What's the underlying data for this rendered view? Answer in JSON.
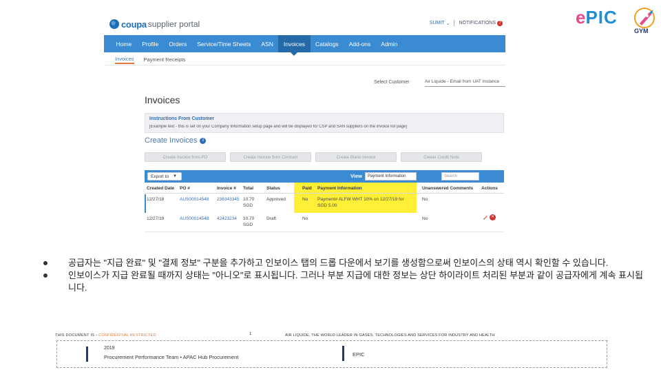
{
  "portal": {
    "brand": "coupa",
    "brand_sub": "supplier portal",
    "user": "SUMIT",
    "user_caret": "⌄",
    "notifications": "NOTIFICATIONS",
    "notif_count": "7",
    "nav": [
      "Home",
      "Profile",
      "Orders",
      "Service/Time Sheets",
      "ASN",
      "Invoices",
      "Catalogs",
      "Add-ons",
      "Admin"
    ],
    "active_nav": "Invoices",
    "subnav": [
      "Invoices",
      "Payment Receipts"
    ],
    "select_customer_label": "Select Customer",
    "select_customer_value": "Air Liquide - Email from UAT Instance",
    "page_title": "Invoices",
    "instructions_title": "Instructions From Customer",
    "instructions_text": "[Example text - this is set on your Company Information setup page and will be displayed for CSP and SAN suppliers on the invoice list page]",
    "create_title": "Create Invoices",
    "create_buttons": [
      "Create Invoice from PO",
      "Create Invoice from Contract",
      "Create Blank Invoice",
      "Create Credit Note"
    ],
    "export_label": "Export to",
    "view_label": "View",
    "view_value": "Payment Information",
    "search_placeholder": "Search",
    "columns": [
      "Created Date",
      "PO #",
      "Invoice #",
      "Total",
      "Status",
      "Paid",
      "Payment Information",
      "Unanswered Comments",
      "Actions"
    ],
    "rows": [
      {
        "created": "12/27/18",
        "po": "AUS00014548",
        "invoice": "236343345",
        "total_1": "10.70",
        "total_2": "SGD",
        "status": "Approved",
        "paid": "No",
        "payment_1": "Payment# ALFW WHT 10% on 12/27/19 for",
        "payment_2": "SGD 5.00",
        "comments": "No"
      },
      {
        "created": "12/27/19",
        "po": "AUS00014548",
        "invoice": "42423234",
        "total_1": "10.70",
        "total_2": "SGD",
        "status": "Draft",
        "paid": "No",
        "payment_1": "",
        "payment_2": "",
        "comments": "No"
      }
    ]
  },
  "logos": {
    "epic_e": "e",
    "epic_rest": "PIC",
    "gym": "GYM"
  },
  "bullets": [
    "공급자는 \"지급 완료\" 및 \"결제 정보\" 구분을 추가하고 인보이스 탭의 드롭 다운에서 보기를 생성함으로써 인보이스의 상태 역시 확인할 수 있습니다.",
    "인보이스가 지급 완료될 때까지 상태는 \"아니오\"로 표시됩니다. 그러나 부분 지급에 대한 정보는 상단 하이라이트 처리된 부분과 같이 공급자에게 계속 표시됩니다."
  ],
  "footer": {
    "conf_prefix": "THIS DOCUMENT IS ",
    "conf_label": "• CONFIDENTIAL RESTRICTED",
    "page_num": "1",
    "tagline": "AIR LIQUIDE, THE WORLD LEADER IN GASES, TECHNOLOGIES AND SERVICES FOR INDUSTRY AND HEALTH",
    "year": "2019",
    "team": "Procurement Performance Team • APAC Hub Procurement",
    "epic": "EPIC"
  },
  "colors": {
    "nav_blue": "#3a8bd1",
    "highlight_yellow": "#ffec14",
    "epic_pink": "#e44b8d",
    "epic_blue": "#1e8fd5"
  }
}
